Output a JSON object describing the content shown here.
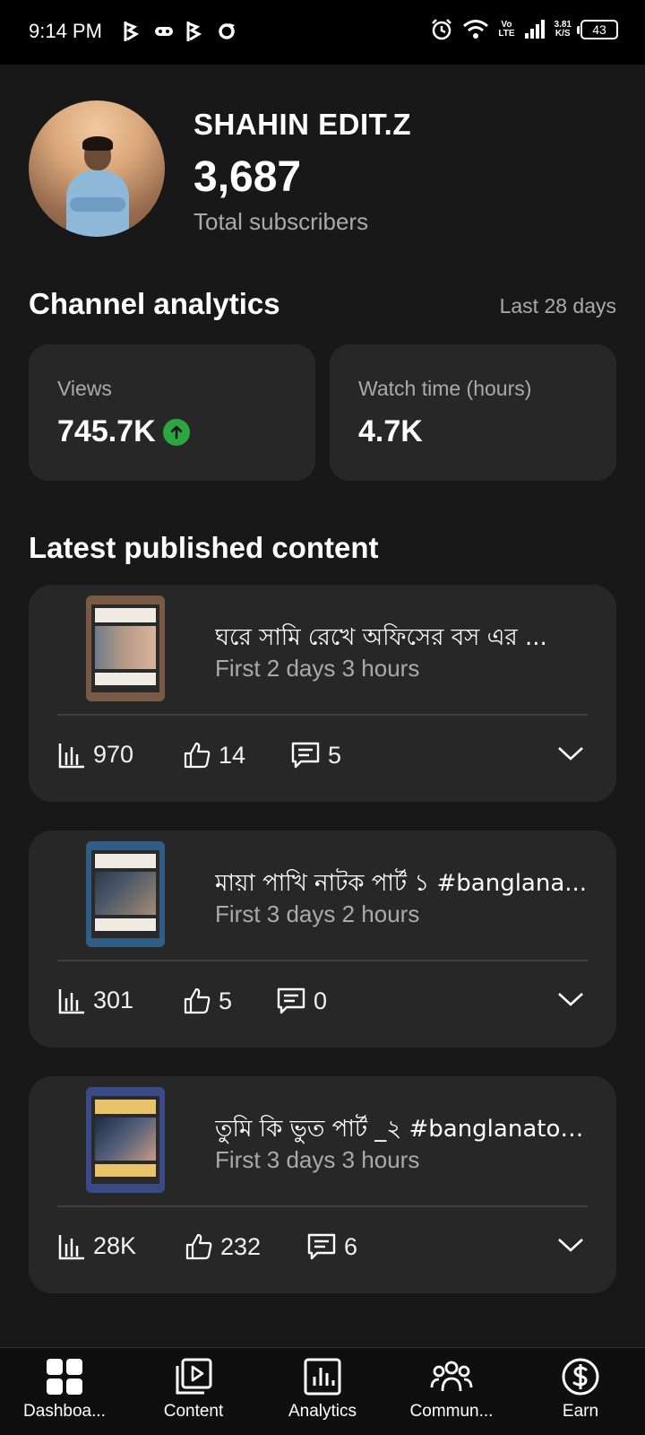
{
  "status_bar": {
    "time": "9:14 PM",
    "network_top": "Vo",
    "network_bottom": "LTE",
    "speed_top": "3.81",
    "speed_bottom": "K/S",
    "battery": "43"
  },
  "profile": {
    "channel_name": "SHAHIN EDIT.Z",
    "subscriber_count": "3,687",
    "subscriber_label": "Total subscribers"
  },
  "analytics": {
    "title": "Channel analytics",
    "period": "Last 28 days",
    "cards": [
      {
        "label": "Views",
        "value": "745.7K",
        "trend": "up",
        "trend_color": "#2ba640"
      },
      {
        "label": "Watch time (hours)",
        "value": "4.7K"
      }
    ]
  },
  "latest": {
    "title": "Latest published content",
    "items": [
      {
        "title": "ঘরে  সামি রেখে অফিসের বস এর ...",
        "subtitle": "First 2 days 3 hours",
        "views": "970",
        "likes": "14",
        "comments": "5",
        "thumb_border": "#7a5a44"
      },
      {
        "title": "মায়া পাখি নাটক পার্ট ১ #banglana...",
        "subtitle": "First 3 days 2 hours",
        "views": "301",
        "likes": "5",
        "comments": "0",
        "thumb_border": "#2f5d86"
      },
      {
        "title": "তুমি কি ভুত পার্ট _২ #banglanatok...",
        "subtitle": "First 3 days 3 hours",
        "views": "28K",
        "likes": "232",
        "comments": "6",
        "thumb_border": "#3a4a86"
      }
    ]
  },
  "bottom_nav": [
    {
      "label": "Dashboa...",
      "icon": "dashboard-icon"
    },
    {
      "label": "Content",
      "icon": "content-icon"
    },
    {
      "label": "Analytics",
      "icon": "analytics-icon"
    },
    {
      "label": "Commun...",
      "icon": "community-icon"
    },
    {
      "label": "Earn",
      "icon": "earn-icon"
    }
  ],
  "colors": {
    "background": "#181818",
    "card": "#272727",
    "secondary_text": "#aaaaaa",
    "accent_green": "#2ba640"
  }
}
